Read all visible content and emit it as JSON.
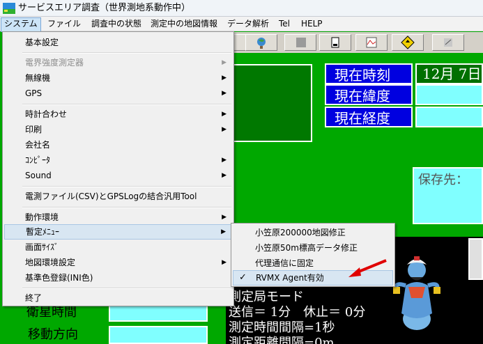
{
  "window": {
    "title": "サービスエリア調査（世界測地系動作中）"
  },
  "menubar": [
    {
      "label": "システム",
      "active": true
    },
    {
      "label": "ファイル"
    },
    {
      "label": "調査中の状態"
    },
    {
      "label": "測定中の地図情報"
    },
    {
      "label": "データ解析"
    },
    {
      "label": "Tel"
    },
    {
      "label": "HELP"
    }
  ],
  "info": {
    "time_label": "現在時刻",
    "time_value": "12月 7日",
    "lat_label": "現在緯度",
    "lon_label": "現在経度",
    "save_label": "保存先："
  },
  "dropdown": {
    "items": [
      {
        "label": "基本設定"
      },
      {
        "label": "電界強度測定器",
        "disabled": true,
        "submenu": true
      },
      {
        "label": "無線機",
        "submenu": true
      },
      {
        "label": "GPS",
        "submenu": true
      },
      {
        "label": "時計合わせ",
        "submenu": true
      },
      {
        "label": "印刷",
        "submenu": true
      },
      {
        "label": "会社名"
      },
      {
        "label": "ｺﾝﾋﾟｰﾀ",
        "submenu": true
      },
      {
        "label": "Sound",
        "submenu": true
      },
      {
        "label": "電測ファイル(CSV)とGPSLogの結合汎用Tool"
      },
      {
        "label": "動作環境",
        "submenu": true
      },
      {
        "label": "暫定ﾒﾆｭｰ",
        "submenu": true,
        "highlighted": true
      },
      {
        "label": "画面ｻｲｽﾞ"
      },
      {
        "label": "地図環境設定",
        "submenu": true
      },
      {
        "label": "基準色登録(INI色)"
      },
      {
        "label": "終了"
      }
    ]
  },
  "submenu": {
    "items": [
      {
        "label": "小笠原200000地図修正"
      },
      {
        "label": "小笠原50m標高データ修正"
      },
      {
        "label": "代理通信に固定"
      },
      {
        "label": "RVMX Agent有効",
        "checked": true,
        "highlighted": true
      }
    ],
    "check_mark": "✓"
  },
  "messages": [
    "測定局モード",
    "送信＝ 1分　休止＝ 0分",
    "測定時間間隔=1秒",
    "測定距離間隔=0m"
  ],
  "left_labels": {
    "satellite_time": "衛星時間",
    "move_direction": "移動方向"
  },
  "colors": {
    "background": "#00a800",
    "label_blue": "#0000e0",
    "value_cyan": "#80ffff",
    "highlight": "#d8e6f2",
    "arrow_red": "#e00000"
  },
  "icons": [
    "app-icon",
    "globe-icon",
    "document-icon",
    "map-icon",
    "warning-diamond-icon",
    "pencil-icon",
    "genie-image",
    "red-arrow-icon"
  ]
}
